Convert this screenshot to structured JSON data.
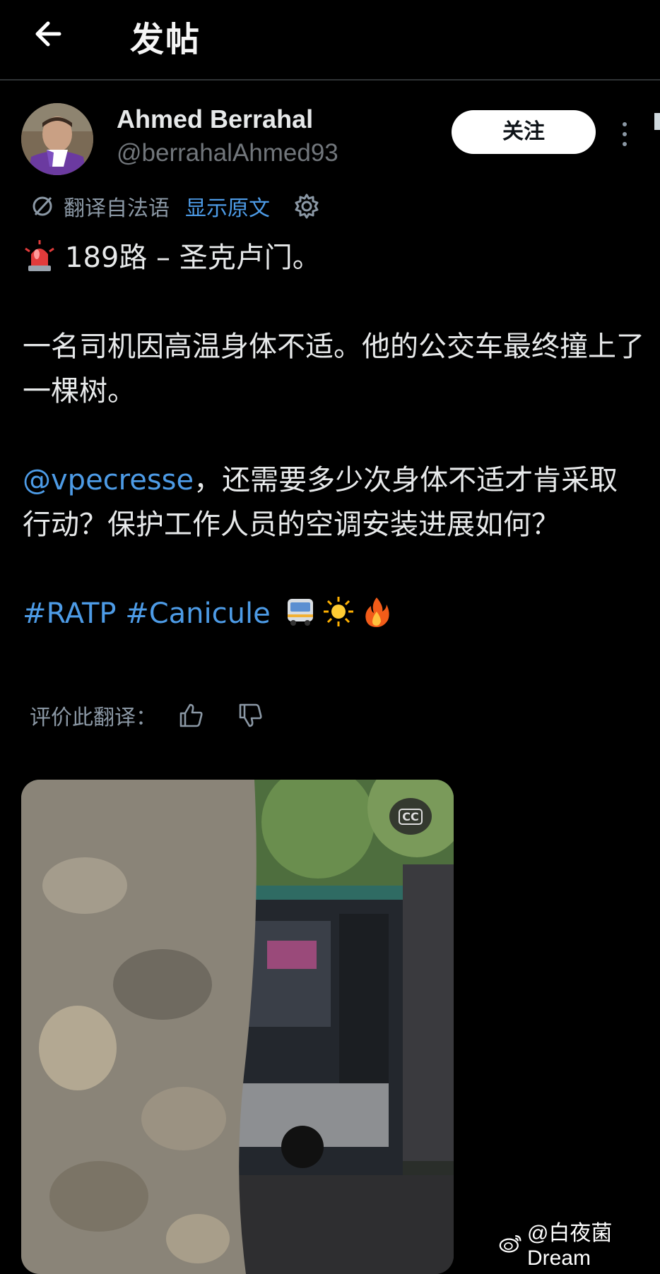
{
  "header": {
    "back_icon": "arrow-left-icon",
    "title": "发帖"
  },
  "author": {
    "name": "Ahmed Berrahal",
    "handle": "@berrahalAhmed93",
    "follow_label": "关注",
    "more_icon": "vertical-ellipsis-icon"
  },
  "translation": {
    "label": "翻译自法语",
    "show_original": "显示原文",
    "settings_icon": "gear-icon"
  },
  "tweet": {
    "line1_icon": "police-light-emoji",
    "line1": "189路 – 圣克卢门。",
    "para2": "一名司机因高温身体不适。他的公交车最终撞上了一棵树。",
    "mention": "@vpecresse",
    "para3_rest": "，还需要多少次身体不适才肯采取行动？保护工作人员的空调安装进展如何？",
    "hashtags": [
      "#RATP",
      "#Canicule"
    ],
    "trailing_emojis": [
      "bus-emoji",
      "sun-emoji",
      "fire-emoji"
    ]
  },
  "rating": {
    "label": "评价此翻译：",
    "up_icon": "thumbs-up-icon",
    "down_icon": "thumbs-down-icon"
  },
  "media": {
    "type": "video",
    "caption_button": "CC"
  },
  "watermark": {
    "icon": "weibo-icon",
    "text": "@白夜菌Dream"
  }
}
